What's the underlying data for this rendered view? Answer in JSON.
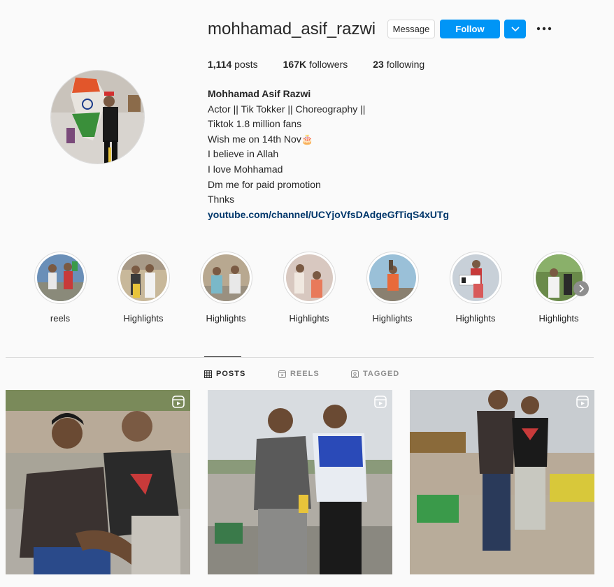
{
  "profile": {
    "username": "mohhamad_asif_razwi",
    "message_label": "Message",
    "follow_label": "Follow",
    "posts_count": "1,114",
    "posts_label": "posts",
    "followers_count": "167K",
    "followers_label": "followers",
    "following_count": "23",
    "following_label": "following",
    "full_name": "Mohhamad Asif Razwi",
    "bio_lines": [
      "Actor || Tik Tokker || Choreography ||",
      "Tiktok 1.8 million fans",
      "Wish me on 14th Nov🎂",
      "I believe in Allah",
      "I love Mohhamad",
      "Dm me for paid promotion",
      "Thnks"
    ],
    "link": "youtube.com/channel/UCYjoVfsDAdgeGfTiqS4xUTg"
  },
  "highlights": [
    {
      "label": "reels"
    },
    {
      "label": "Highlights"
    },
    {
      "label": "Highlights"
    },
    {
      "label": "Highlights"
    },
    {
      "label": "Highlights"
    },
    {
      "label": "Highlights"
    },
    {
      "label": "Highlights"
    }
  ],
  "tabs": [
    {
      "label": "POSTS",
      "icon": "grid-icon",
      "active": true
    },
    {
      "label": "REELS",
      "icon": "reels-icon",
      "active": false
    },
    {
      "label": "TAGGED",
      "icon": "tagged-icon",
      "active": false
    }
  ],
  "colors": {
    "accent": "#0095f6",
    "link": "#00376b",
    "muted": "#8e8e8e"
  }
}
